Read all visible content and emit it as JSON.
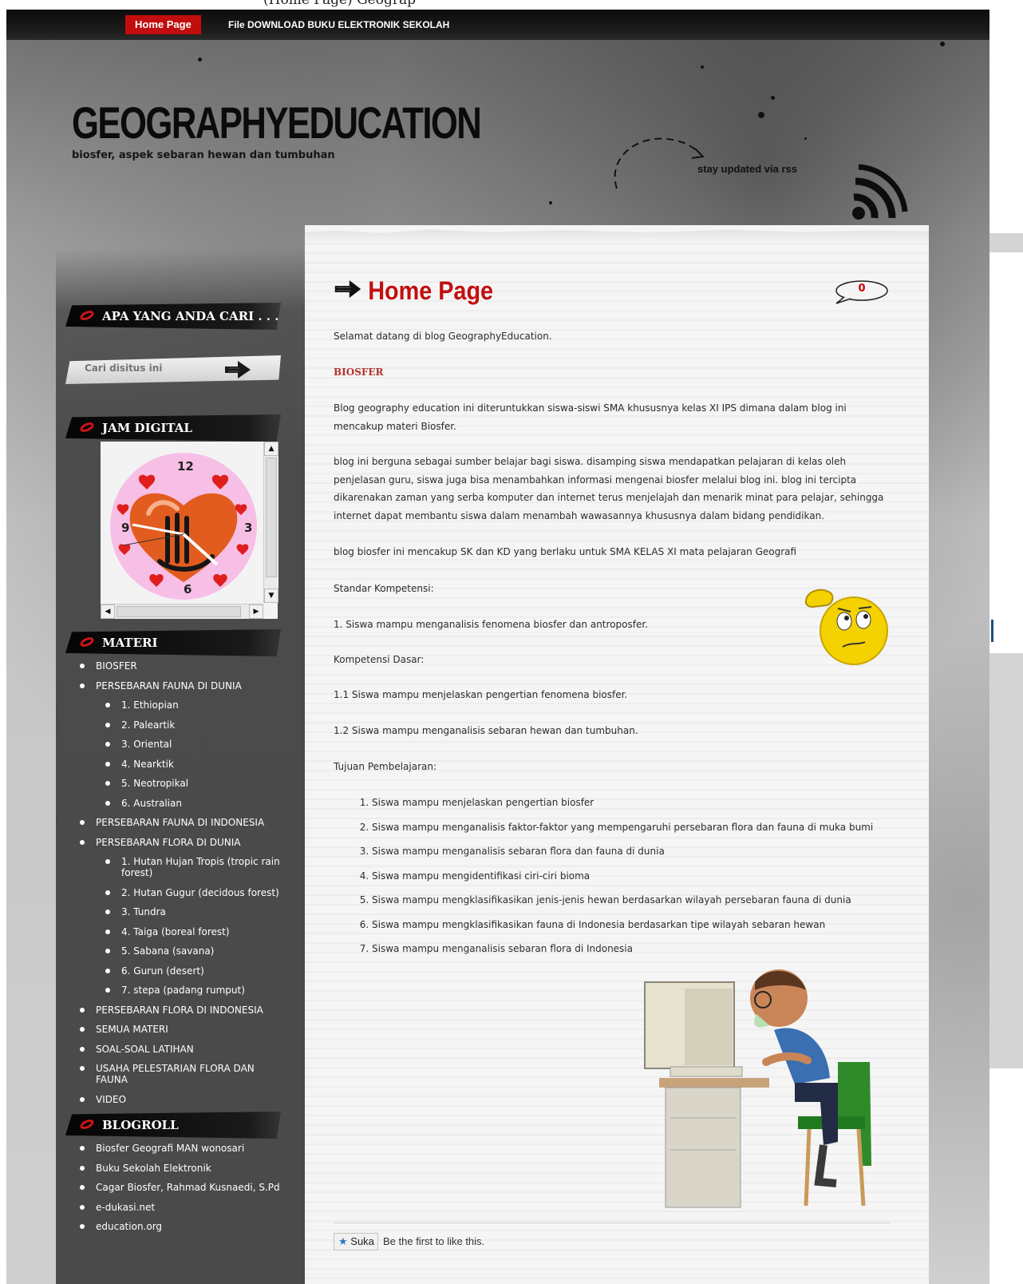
{
  "top_cut_text": "(Home Page) Geograp",
  "nav": {
    "items": [
      {
        "label": "Home Page",
        "active": true
      },
      {
        "label": "File DOWNLOAD BUKU ELEKTRONIK SEKOLAH",
        "active": false
      }
    ]
  },
  "header": {
    "title": "GEOGRAPHYEDUCATION",
    "description": "biosfer, aspek sebaran hewan dan tumbuhan",
    "rss_label": "stay updated via rss"
  },
  "sidebar": {
    "search_widget_title": "APA YANG ANDA CARI . . . .",
    "search_placeholder": "Cari disitus ini",
    "clock_widget_title": "JAM DIGITAL",
    "clock_numbers": [
      "12",
      "3",
      "6",
      "9"
    ],
    "materi_title": "MATERI",
    "materi": [
      {
        "label": "BIOSFER",
        "level": 0
      },
      {
        "label": "PERSEBARAN FAUNA DI DUNIA",
        "level": 0
      },
      {
        "label": "1. Ethiopian",
        "level": 1
      },
      {
        "label": "2. Paleartik",
        "level": 1
      },
      {
        "label": "3. Oriental",
        "level": 1
      },
      {
        "label": "4. Nearktik",
        "level": 1
      },
      {
        "label": "5. Neotropikal",
        "level": 1
      },
      {
        "label": "6. Australian",
        "level": 1
      },
      {
        "label": "PERSEBARAN FAUNA DI INDONESIA",
        "level": 0
      },
      {
        "label": "PERSEBARAN FLORA DI DUNIA",
        "level": 0
      },
      {
        "label": "1. Hutan Hujan Tropis (tropic rain forest)",
        "level": 1
      },
      {
        "label": "2. Hutan Gugur (decidous forest)",
        "level": 1
      },
      {
        "label": "3. Tundra",
        "level": 1
      },
      {
        "label": "4. Taiga (boreal forest)",
        "level": 1
      },
      {
        "label": "5. Sabana (savana)",
        "level": 1
      },
      {
        "label": "6. Gurun (desert)",
        "level": 1
      },
      {
        "label": "7. stepa (padang rumput)",
        "level": 1
      },
      {
        "label": "PERSEBARAN FLORA DI INDONESIA",
        "level": 0
      },
      {
        "label": "SEMUA MATERI",
        "level": 0
      },
      {
        "label": "SOAL-SOAL LATIHAN",
        "level": 0
      },
      {
        "label": "USAHA PELESTARIAN FLORA DAN FAUNA",
        "level": 0
      },
      {
        "label": "VIDEO",
        "level": 0
      }
    ],
    "blogroll_title": "BLOGROLL",
    "blogroll": [
      "Biosfer Geografi MAN wonosari",
      "Buku Sekolah Elektronik",
      "Cagar Biosfer, Rahmad Kusnaedi, S.Pd",
      "e-dukasi.net",
      "education.org"
    ]
  },
  "post": {
    "title": "Home Page",
    "comment_count": "0",
    "welcome": "Selamat datang di blog GeographyEducation.",
    "section_heading": "BIOSFER",
    "para1": "Blog geography education ini diteruntukkan siswa-siswi SMA khususnya kelas XI IPS dimana dalam blog ini mencakup materi Biosfer.",
    "para2": "blog ini berguna sebagai sumber belajar bagi siswa. disamping siswa mendapatkan pelajaran di kelas oleh penjelasan guru, siswa juga bisa menambahkan informasi mengenai biosfer melalui blog ini. blog ini tercipta dikarenakan zaman yang serba komputer dan internet terus menjelajah dan menarik minat para pelajar, sehingga internet dapat membantu siswa dalam menambah wawasannya khususnya dalam bidang pendidikan.",
    "para3": "blog biosfer ini mencakup SK dan KD yang berlaku untuk SMA KELAS XI mata pelajaran Geografi",
    "sk_label": "Standar Kompetensi:",
    "sk_item": "1. Siswa mampu menganalisis fenomena biosfer dan antroposfer.",
    "kd_label": "Kompetensi Dasar:",
    "kd_item1": "1.1 Siswa mampu menjelaskan pengertian fenomena biosfer.",
    "kd_item2": "1.2 Siswa mampu menganalisis sebaran hewan dan tumbuhan.",
    "goals_label": "Tujuan Pembelajaran:",
    "goals": [
      "Siswa mampu menjelaskan pengertian biosfer",
      "Siswa mampu menganalisis faktor-faktor yang mempengaruhi persebaran flora dan fauna di muka bumi",
      "Siswa mampu menganalisis sebaran flora dan fauna di dunia",
      "Siswa mampu mengidentifikasi ciri-ciri bioma",
      "Siswa mampu mengklasifikasikan jenis-jenis hewan  berdasarkan wilayah persebaran fauna di dunia",
      "Siswa mampu mengklasifikasikan fauna di Indonesia berdasarkan tipe wilayah sebaran hewan",
      "Siswa mampu menganalisis sebaran flora di Indonesia"
    ],
    "like_button": "Suka",
    "like_text": "Be the first to like this."
  },
  "colors": {
    "accent_red": "#c20f0f",
    "nav_active_bg": "#c10d0d",
    "sidebar_bg": "#4a4a4a",
    "content_bg": "#f5f5f5"
  }
}
